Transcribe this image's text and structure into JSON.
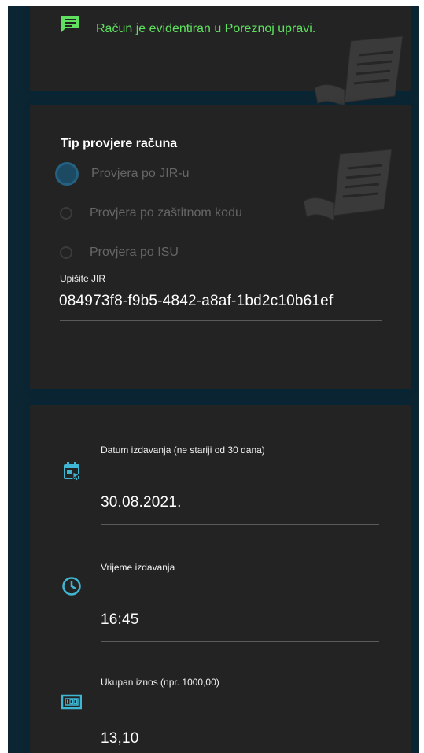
{
  "status": {
    "message": "Račun je evidentiran u Poreznoj upravi.",
    "icon": "message-icon",
    "color": "#5fe05f"
  },
  "check": {
    "title": "Tip provjere računa",
    "options": [
      {
        "label": "Provjera po JIR-u",
        "selected": true
      },
      {
        "label": "Provjera po zaštitnom kodu",
        "selected": false
      },
      {
        "label": "Provjera po ISU",
        "selected": false
      }
    ],
    "jir_label": "Upišite JIR",
    "jir_value": "084973f8-f9b5-4842-a8af-1bd2c10b61ef"
  },
  "details": {
    "date_label": "Datum izdavanja (ne stariji od 30 dana)",
    "date_value": "30.08.2021.",
    "time_label": "Vrijeme izdavanja",
    "time_value": "16:45",
    "amount_label": "Ukupan iznos (npr. 1000,00)",
    "amount_value": "13,10",
    "icons": [
      "calendar-icon",
      "clock-icon",
      "cash-icon"
    ],
    "accent": "#3fb7d4"
  }
}
